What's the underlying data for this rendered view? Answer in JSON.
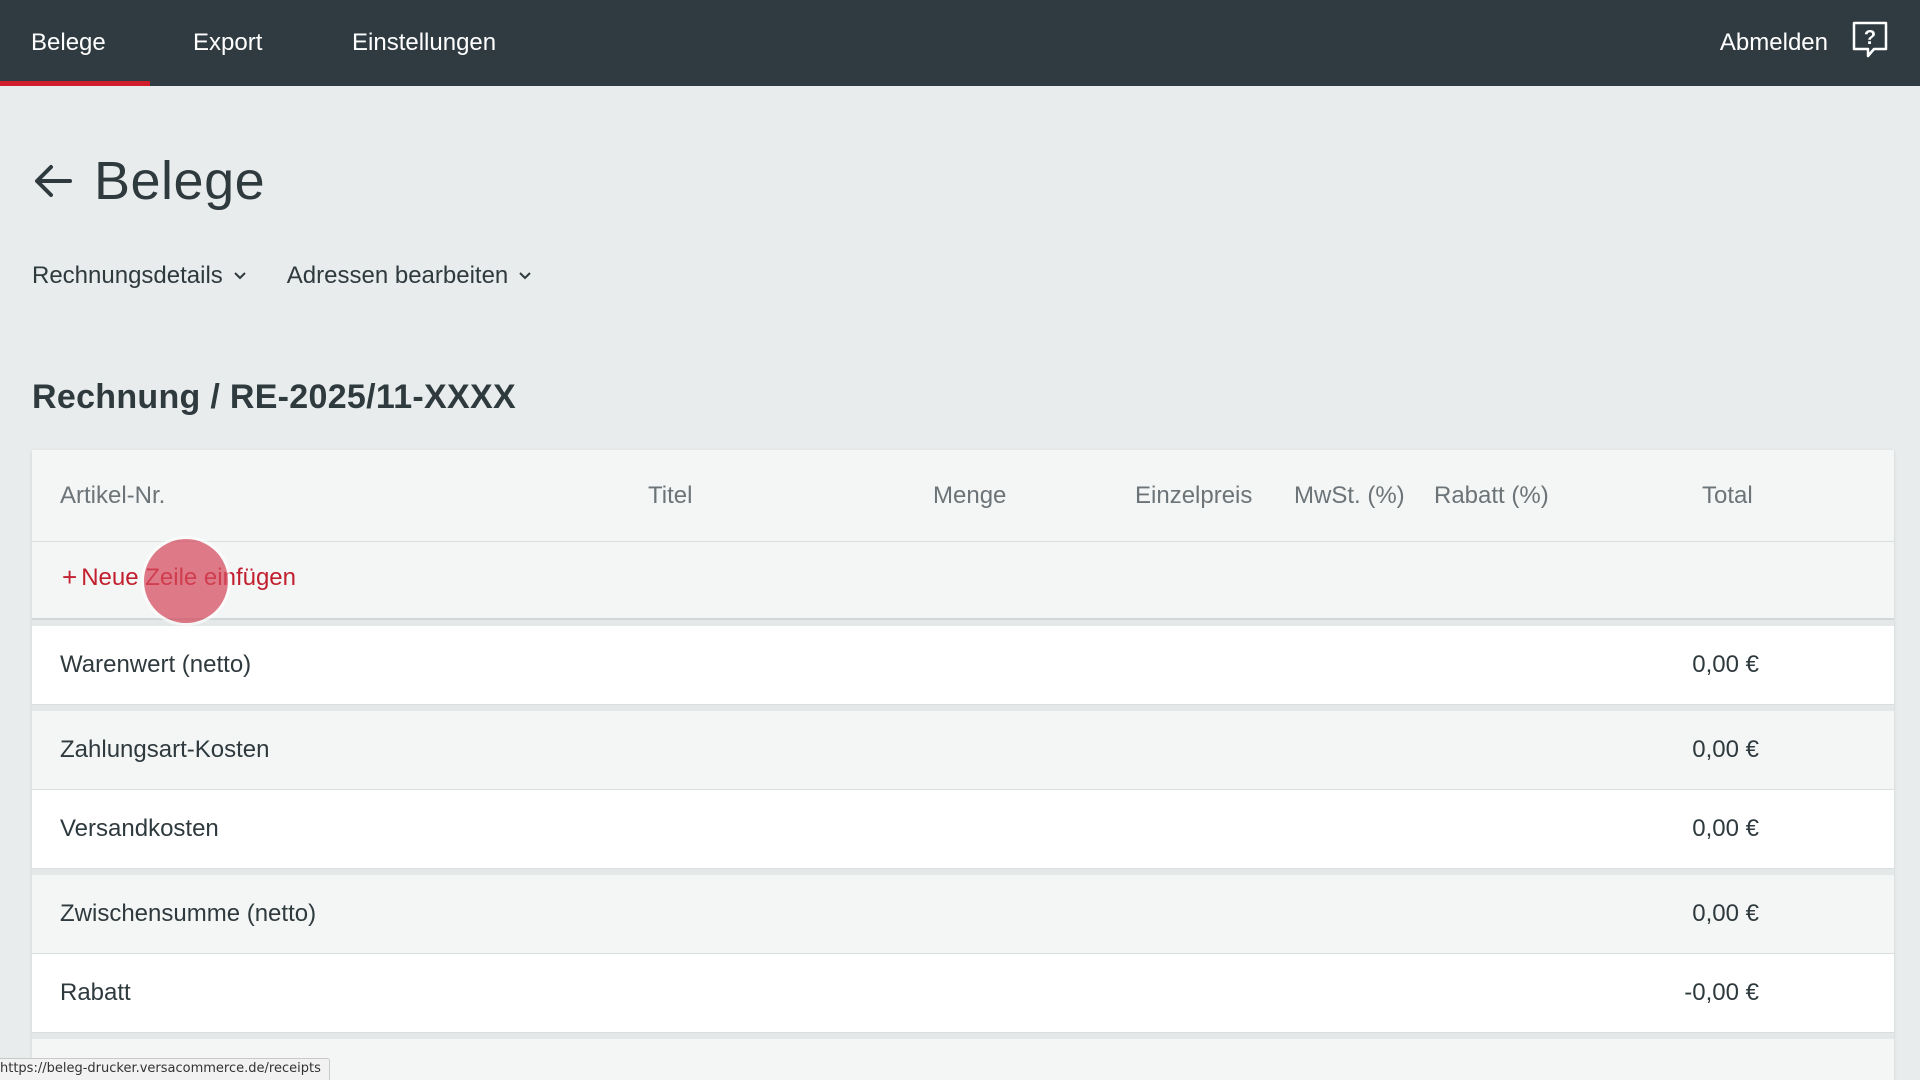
{
  "nav": {
    "tabs": [
      {
        "label": "Belege",
        "active": true
      },
      {
        "label": "Export",
        "active": false
      },
      {
        "label": "Einstellungen",
        "active": false
      }
    ],
    "logout_label": "Abmelden",
    "help_icon": "help-bubble-icon"
  },
  "header": {
    "back_icon": "arrow-left-icon",
    "title": "Belege"
  },
  "dropdowns": [
    {
      "label": "Rechnungsdetails",
      "icon": "chevron-down-icon"
    },
    {
      "label": "Adressen bearbeiten",
      "icon": "chevron-down-icon"
    }
  ],
  "document": {
    "title": "Rechnung / RE-2025/11-XXXX"
  },
  "table": {
    "columns": [
      "Artikel-Nr.",
      "Titel",
      "Menge",
      "Einzelpreis",
      "MwSt. (%)",
      "Rabatt (%)",
      "Total"
    ],
    "add_row_label": "Neue Zeile einfügen",
    "add_row_icon": "+"
  },
  "summary": [
    {
      "label": "Warenwert (netto)",
      "value": "0,00 €"
    },
    {
      "label": "Zahlungsart-Kosten",
      "value": "0,00 €"
    },
    {
      "label": "Versandkosten",
      "value": "0,00 €"
    },
    {
      "label": "Zwischensumme (netto)",
      "value": "0,00 €"
    },
    {
      "label": "Rabatt",
      "value": "-0,00 €"
    }
  ],
  "status_url": "https://beleg-drucker.versacommerce.de/receipts",
  "colors": {
    "nav_bg": "#2f3b40",
    "accent": "#d01e2c",
    "page_bg": "#e8ecec"
  }
}
